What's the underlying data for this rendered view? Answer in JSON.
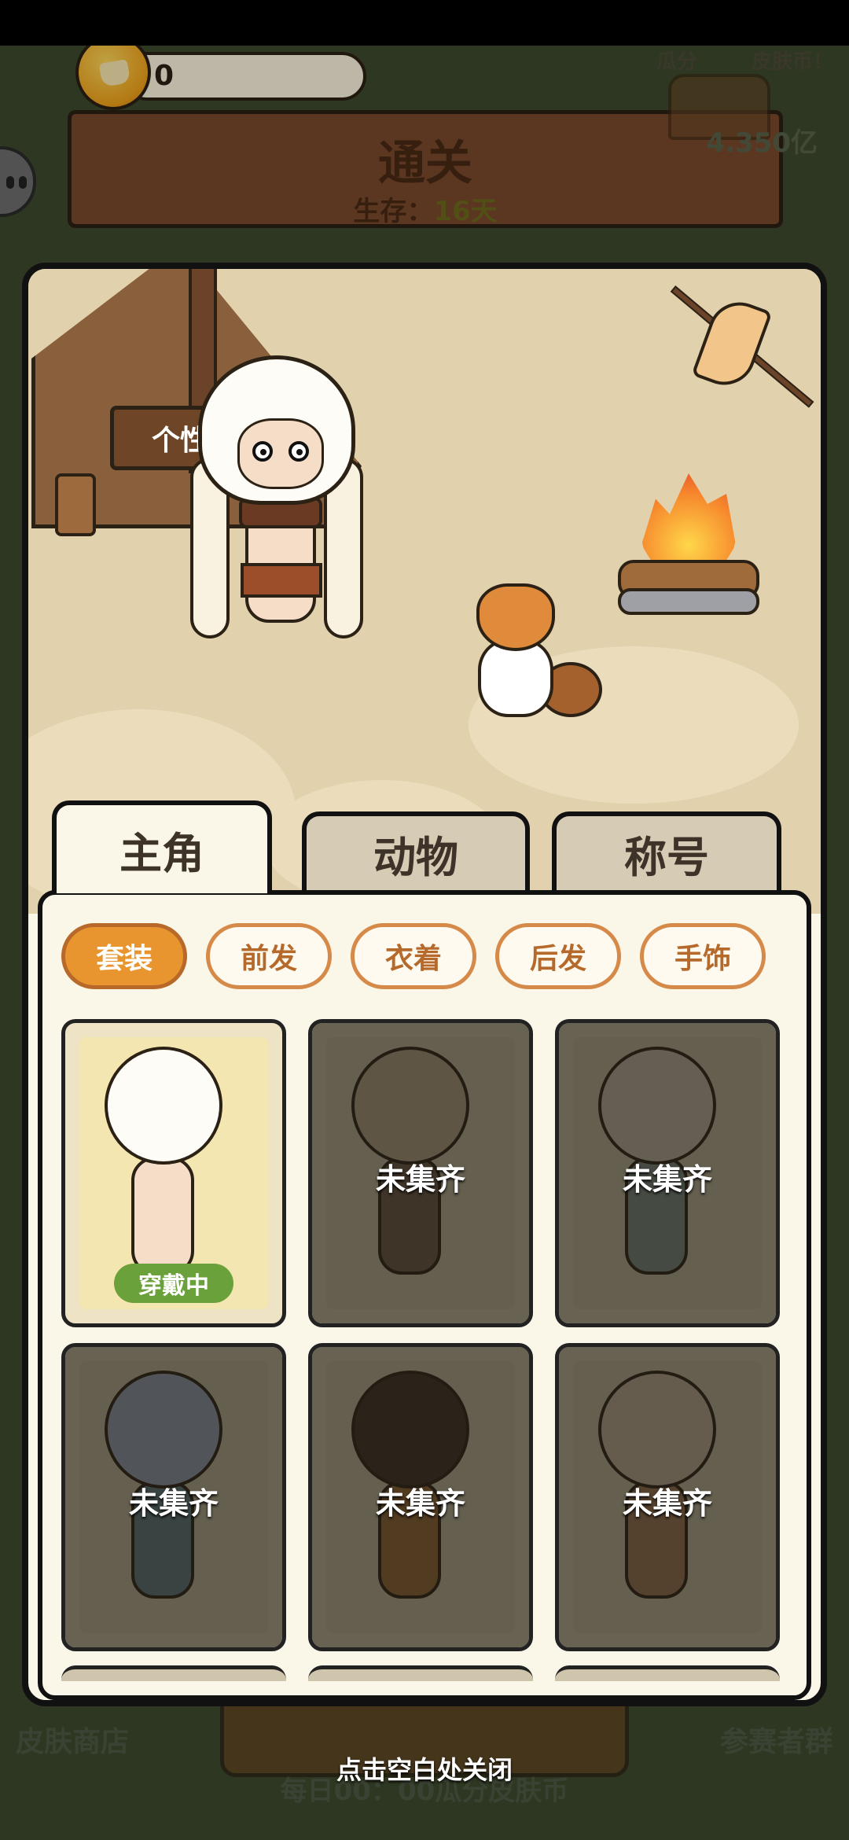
{
  "hud": {
    "coin_count": "0",
    "banner_title": "通关",
    "survival_label": "生存：",
    "survival_days": "16天",
    "share_label": "瓜分",
    "share_suffix": "皮肤币！",
    "share_amount": "4.350亿"
  },
  "modal": {
    "sign_text": "个性定制",
    "tabs": [
      {
        "label": "主角",
        "active": true
      },
      {
        "label": "动物",
        "active": false
      },
      {
        "label": "称号",
        "active": false
      }
    ],
    "filters": [
      {
        "label": "套装",
        "active": true
      },
      {
        "label": "前发",
        "active": false
      },
      {
        "label": "衣着",
        "active": false
      },
      {
        "label": "后发",
        "active": false
      },
      {
        "label": "手饰",
        "active": false
      }
    ],
    "outfits": [
      {
        "status": "穿戴中",
        "locked": false
      },
      {
        "status": "未集齐",
        "locked": true
      },
      {
        "status": "未集齐",
        "locked": true
      },
      {
        "status": "未集齐",
        "locked": true
      },
      {
        "status": "未集齐",
        "locked": true
      },
      {
        "status": "未集齐",
        "locked": true
      }
    ]
  },
  "footer": {
    "skin_shop": "皮肤商店",
    "participant_group": "参赛者群",
    "daily_text": "每日00：00瓜分皮肤币",
    "close_hint": "点击空白处关闭"
  },
  "colors": {
    "accent_orange": "#e8952f",
    "chip_border": "#d58a49",
    "wearing_green": "#6aa13a",
    "panel_bg": "#fbf7e8"
  }
}
